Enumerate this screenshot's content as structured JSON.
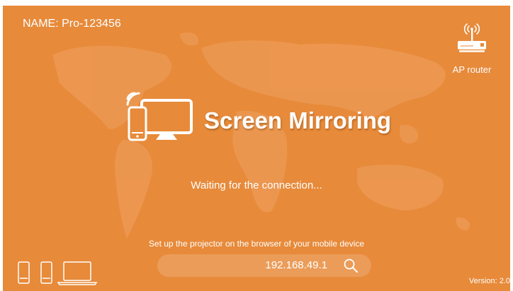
{
  "header": {
    "device_name": "NAME:  Pro-123456"
  },
  "router": {
    "icon": "router-icon",
    "label": "AP router"
  },
  "main": {
    "icon": "screen-mirroring-icon",
    "title": "Screen Mirroring",
    "status": "Waiting for the connection..."
  },
  "footer": {
    "hint": "Set up the projector on the browser of your mobile device",
    "ip_address": "192.168.49.1",
    "search_icon": "search-icon",
    "device_icons": [
      "phone-icon",
      "phone-icon",
      "laptop-icon"
    ],
    "version": "Version: 2.0"
  },
  "colors": {
    "background": "#e78a3a",
    "map": "#f0a564",
    "text": "#ffffff"
  }
}
